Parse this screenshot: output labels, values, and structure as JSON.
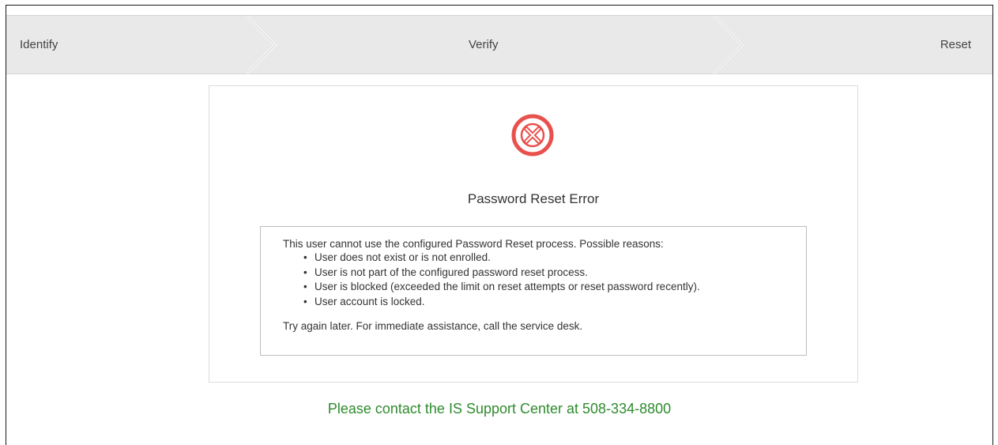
{
  "steps": [
    {
      "label": "Identify"
    },
    {
      "label": "Verify"
    },
    {
      "label": "Reset"
    }
  ],
  "colors": {
    "error_icon": "#e8514d",
    "contact_text": "#2e8b2e",
    "stepper_bg": "#e9e9e9"
  },
  "card": {
    "icon": "error-circle-x-icon",
    "title": "Password Reset Error",
    "message": {
      "heading": "This user cannot use the configured Password Reset process. Possible reasons:",
      "reasons": [
        "User does not exist or is not enrolled.",
        "User is not part of the configured password reset process.",
        "User is blocked (exceeded the limit on reset attempts or reset password recently).",
        "User account is locked."
      ],
      "footer": "Try again later. For immediate assistance, call the service desk."
    }
  },
  "contact": {
    "text": "Please contact the IS Support Center at 508-334-8800"
  }
}
